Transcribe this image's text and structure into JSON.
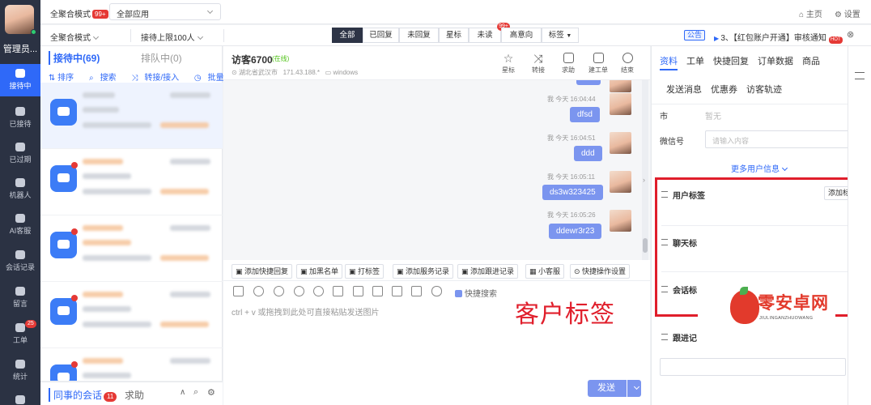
{
  "rail": {
    "user_name": "管理员...",
    "items": [
      {
        "label": "接待中",
        "icon": "chat-icon",
        "active": true
      },
      {
        "label": "已接待",
        "icon": "chat-done-icon"
      },
      {
        "label": "已过期",
        "icon": "expired-icon"
      },
      {
        "label": "机器人",
        "icon": "robot-icon"
      },
      {
        "label": "AI客服",
        "icon": "ai-icon"
      },
      {
        "label": "会话记录",
        "icon": "record-icon"
      },
      {
        "label": "留言",
        "icon": "message-icon"
      },
      {
        "label": "工单",
        "icon": "ticket-icon",
        "badge": "25"
      },
      {
        "label": "统计",
        "icon": "stats-icon"
      }
    ]
  },
  "topbar": {
    "mode": "全聚合模式",
    "mode_badge": "99+",
    "app_select": "全部应用",
    "home": "主页",
    "settings": "设置"
  },
  "filterbar": {
    "mode": "全聚合模式",
    "limit": "接待上限100人",
    "segments": [
      "全部",
      "已回复",
      "未回复",
      "星标",
      "未读",
      "高意向",
      "标签"
    ],
    "segment_badge": "99+",
    "notice_tag": "公告",
    "notice_text": "3、【红包账户开通】审核通知",
    "notice_hot": "HOT"
  },
  "sessions": {
    "tab_active": "接待中(69)",
    "tab_queue": "排队中(0)",
    "actions": [
      "排序",
      "搜索",
      "转接/接入",
      "批量结束"
    ],
    "bottom_tab": "同事的会话",
    "bottom_badge": "11",
    "bottom_help": "求助"
  },
  "chat": {
    "visitor": "访客6700",
    "status": "在线",
    "location": "湖北省武汉市",
    "ip": "171.43.188.*",
    "os": "windows",
    "tools": [
      "星标",
      "转接",
      "求助",
      "建工单",
      "结束"
    ],
    "messages": [
      {
        "meta": "我 今天 16:04:44",
        "text": "dfsd"
      },
      {
        "meta": "我 今天 16:04:51",
        "text": "ddd"
      },
      {
        "meta": "我 今天 16:05:11",
        "text": "ds3w323425"
      },
      {
        "meta": "我 今天 16:05:26",
        "text": "ddewr3r23"
      }
    ],
    "quick_buttons": [
      "添加快捷回复",
      "加黑名单",
      "打标签",
      "添加服务记录",
      "添加跟进记录",
      "小客服",
      "快捷操作设置"
    ],
    "quick_search": "快捷搜索",
    "placeholder": "ctrl + v 或拖拽到此处可直接粘贴发送图片",
    "overlay_label": "客户标签",
    "send": "发送"
  },
  "rpanel": {
    "tabs": [
      "资料",
      "工单",
      "快捷回复",
      "订单数据",
      "商品"
    ],
    "tabs2": [
      "发送消息",
      "优惠券",
      "访客轨迹"
    ],
    "city_label": "市",
    "city_value": "暂无",
    "wechat_label": "微信号",
    "wechat_placeholder": "请输入内容",
    "more": "更多用户信息",
    "sections": [
      "用户标签",
      "聊天标",
      "会话标",
      "跟进记"
    ],
    "add_tag": "添加标签"
  },
  "watermark": {
    "text": "零安卓网",
    "sub": "JIULINGANZHUOWANG"
  }
}
